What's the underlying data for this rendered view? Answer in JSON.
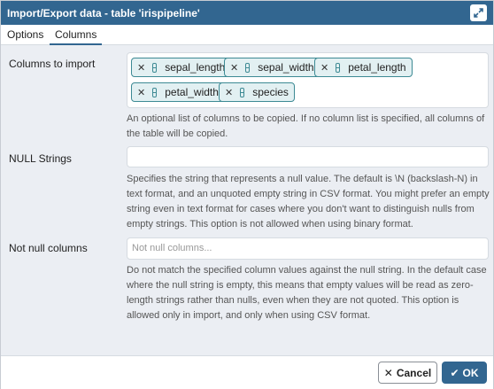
{
  "window": {
    "title": "Import/Export data - table 'irispipeline'"
  },
  "tabs": [
    {
      "label": "Options",
      "active": false
    },
    {
      "label": "Columns",
      "active": true
    }
  ],
  "columns_to_import": {
    "label": "Columns to import",
    "chips": [
      "sepal_length",
      "sepal_width",
      "petal_length",
      "petal_width",
      "species"
    ],
    "help": "An optional list of columns to be copied. If no column list is specified, all columns of the table will be copied."
  },
  "null_strings": {
    "label": "NULL Strings",
    "value": "",
    "help": "Specifies the string that represents a null value. The default is \\N (backslash-N) in text format, and an unquoted empty string in CSV format. You might prefer an empty string even in text format for cases where you don't want to distinguish nulls from empty strings. This option is not allowed when using binary format."
  },
  "not_null_columns": {
    "label": "Not null columns",
    "placeholder": "Not null columns...",
    "help": "Do not match the specified column values against the null string. In the default case where the null string is empty, this means that empty values will be read as zero-length strings rather than nulls, even when they are not quoted. This option is allowed only in import, and only when using CSV format."
  },
  "footer": {
    "cancel_label": "Cancel",
    "ok_label": "OK"
  },
  "icons": {
    "maximize": "maximize-icon",
    "chip_remove": "close-icon",
    "column": "column-icon",
    "cancel": "close-icon",
    "ok": "check-icon"
  },
  "colors": {
    "titlebar": "#326690",
    "chip_border": "#3d8a94",
    "chip_bg": "#e2f0f2",
    "ok_button": "#326690"
  }
}
